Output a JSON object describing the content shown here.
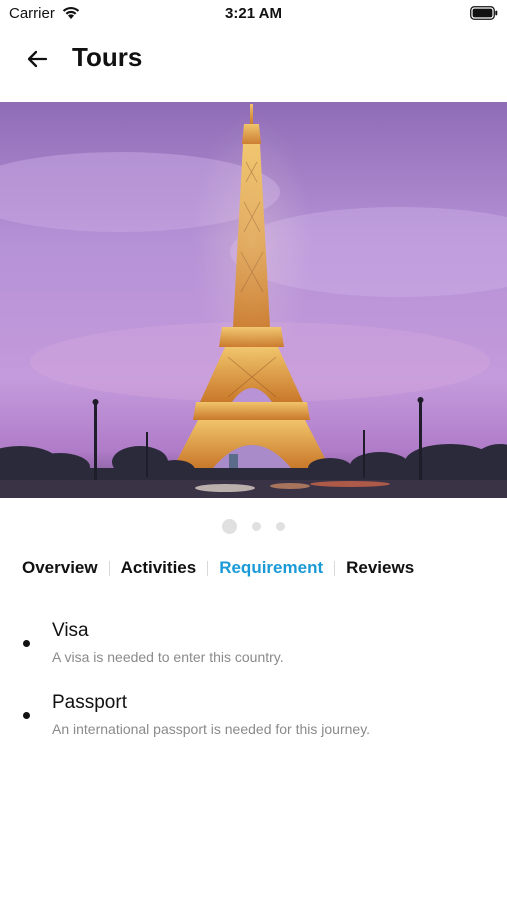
{
  "status_bar": {
    "carrier": "Carrier",
    "time": "3:21 AM",
    "wifi_icon": "wifi-icon",
    "battery_icon": "battery-icon"
  },
  "header": {
    "back_icon": "arrow-left-icon",
    "title": "Tours"
  },
  "hero": {
    "image_subject": "Eiffel Tower at dusk, purple sky"
  },
  "carousel": {
    "count": 3,
    "active_index": 0
  },
  "tabs": [
    {
      "label": "Overview",
      "active": false
    },
    {
      "label": "Activities",
      "active": false
    },
    {
      "label": "Requirement",
      "active": true
    },
    {
      "label": "Reviews",
      "active": false
    }
  ],
  "requirements": [
    {
      "title": "Visa",
      "description": "A visa is needed to enter this country."
    },
    {
      "title": "Passport",
      "description": "An international passport is needed for this journey."
    }
  ],
  "colors": {
    "accent": "#1a9bd7",
    "text": "#111111",
    "muted": "#8a8a8a",
    "sky": "#b48cd2"
  }
}
